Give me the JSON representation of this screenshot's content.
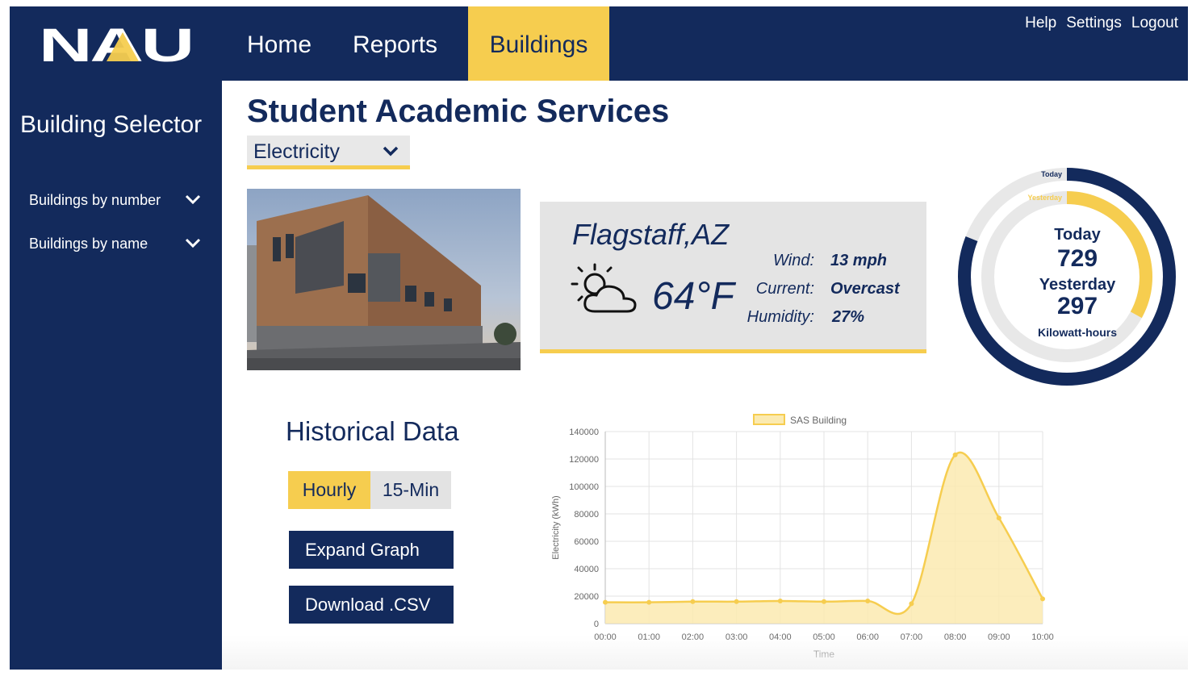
{
  "brand": {
    "logo_text": "NAU",
    "navy": "#132a5c",
    "gold": "#f6cd4f"
  },
  "nav": {
    "items": [
      {
        "label": "Home",
        "active": false
      },
      {
        "label": "Reports",
        "active": false
      },
      {
        "label": "Buildings",
        "active": true
      }
    ],
    "util": [
      "Help",
      "Settings",
      "Logout"
    ]
  },
  "sidebar": {
    "title": "Building Selector",
    "items": [
      {
        "label": "Buildings by number",
        "icon": "chevron-down-icon"
      },
      {
        "label": "Buildings by name",
        "icon": "chevron-down-icon"
      }
    ]
  },
  "page": {
    "title": "Student Academic Services",
    "metric": {
      "selected": "Electricity",
      "icon": "chevron-down-icon"
    }
  },
  "weather": {
    "city": "Flagstaff,AZ",
    "icon": "partly-cloudy-icon",
    "temperature": "64°F",
    "wind_label": "Wind:",
    "wind": "13 mph",
    "current_label": "Current:",
    "current": "Overcast",
    "humidity_label": "Humidity:",
    "humidity": "27%"
  },
  "usage": {
    "legend_today": "Today",
    "legend_yesterday": "Yesterday",
    "today_label": "Today",
    "today_value": "729",
    "yesterday_label": "Yesterday",
    "yesterday_value": "297",
    "unit": "Kilowatt-hours",
    "today_fraction": 0.81,
    "yesterday_fraction": 0.33
  },
  "historical": {
    "title": "Historical Data",
    "toggles": [
      {
        "label": "Hourly",
        "active": true
      },
      {
        "label": "15-Min",
        "active": false
      }
    ],
    "expand_label": "Expand Graph",
    "download_label": "Download .CSV"
  },
  "chart_data": {
    "type": "area",
    "x": [
      "00:00",
      "01:00",
      "02:00",
      "03:00",
      "04:00",
      "05:00",
      "06:00",
      "07:00",
      "08:00",
      "09:00",
      "10:00"
    ],
    "series": [
      {
        "name": "SAS Building",
        "values": [
          15500,
          15500,
          16000,
          16000,
          16500,
          16000,
          16500,
          14500,
          123000,
          77000,
          18000
        ]
      }
    ],
    "xlabel": "Time",
    "ylabel": "Electricity (kWh)",
    "ylim": [
      0,
      140000
    ],
    "yticks": [
      0,
      20000,
      40000,
      60000,
      80000,
      100000,
      120000,
      140000
    ],
    "grid": true,
    "legend": "top-center",
    "line_color": "#f6cd4f",
    "fill_color": "#fbeab0"
  }
}
